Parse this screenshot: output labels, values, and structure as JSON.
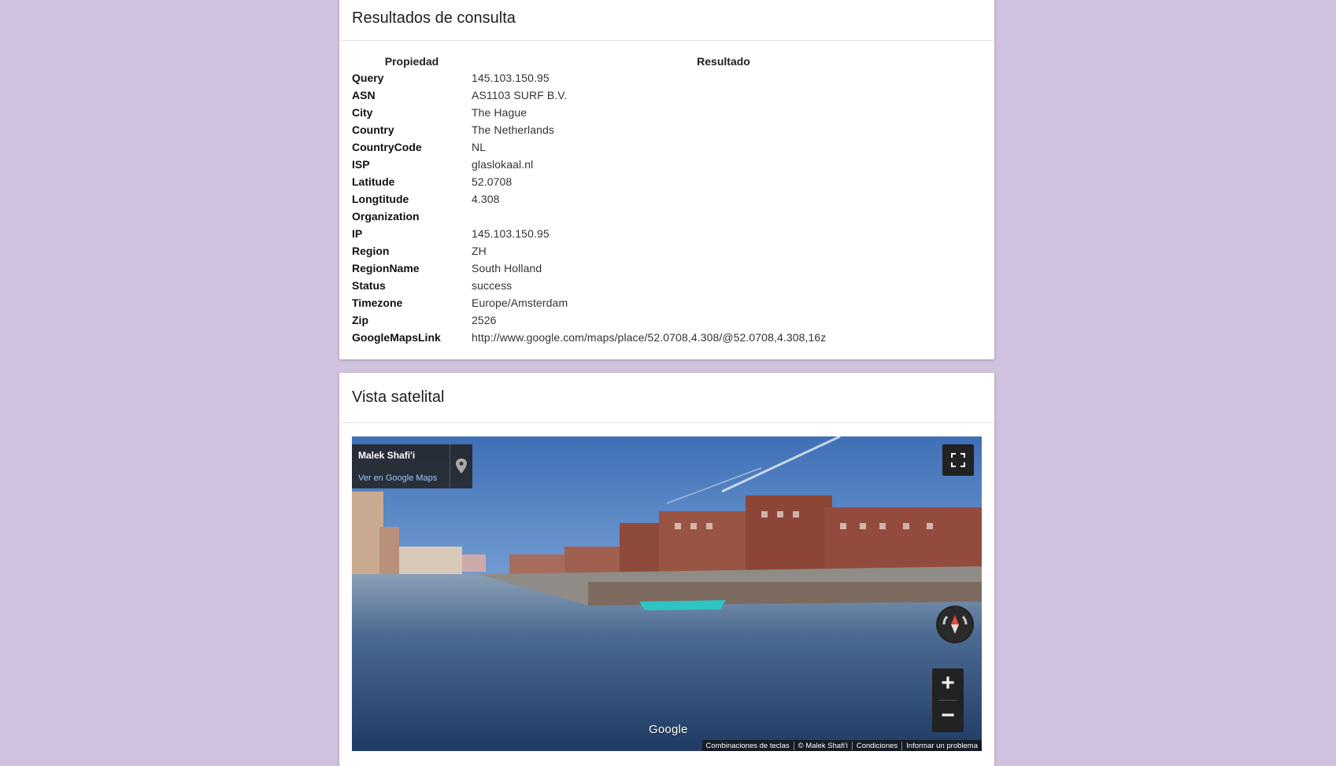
{
  "results_card": {
    "title": "Resultados de consulta",
    "headers": {
      "property": "Propiedad",
      "result": "Resultado"
    },
    "rows": [
      {
        "property": "Query",
        "value": "145.103.150.95"
      },
      {
        "property": "ASN",
        "value": "AS1103 SURF B.V."
      },
      {
        "property": "City",
        "value": "The Hague"
      },
      {
        "property": "Country",
        "value": "The Netherlands"
      },
      {
        "property": "CountryCode",
        "value": "NL"
      },
      {
        "property": "ISP",
        "value": "glaslokaal.nl"
      },
      {
        "property": "Latitude",
        "value": "52.0708"
      },
      {
        "property": "Longtitude",
        "value": "4.308"
      },
      {
        "property": "Organization",
        "value": ""
      },
      {
        "property": "IP",
        "value": "145.103.150.95"
      },
      {
        "property": "Region",
        "value": "ZH"
      },
      {
        "property": "RegionName",
        "value": "South Holland"
      },
      {
        "property": "Status",
        "value": "success"
      },
      {
        "property": "Timezone",
        "value": "Europe/Amsterdam"
      },
      {
        "property": "Zip",
        "value": "2526"
      },
      {
        "property": "GoogleMapsLink",
        "value": "http://www.google.com/maps/place/52.0708,4.308/@52.0708,4.308,16z"
      }
    ]
  },
  "map_card": {
    "title": "Vista satelital",
    "info_box": {
      "name": "Malek Shafi'i",
      "link": "Ver en Google Maps"
    },
    "google_logo": "Google",
    "footer": [
      "Combinaciones de teclas",
      "© Malek Shafi'i",
      "Condiciones",
      "Informar un problema"
    ],
    "zoom": {
      "in": "+",
      "out": "−"
    },
    "icons": {
      "fullscreen": "fullscreen-icon",
      "compass": "compass-icon",
      "pin": "map-pin-icon"
    }
  }
}
